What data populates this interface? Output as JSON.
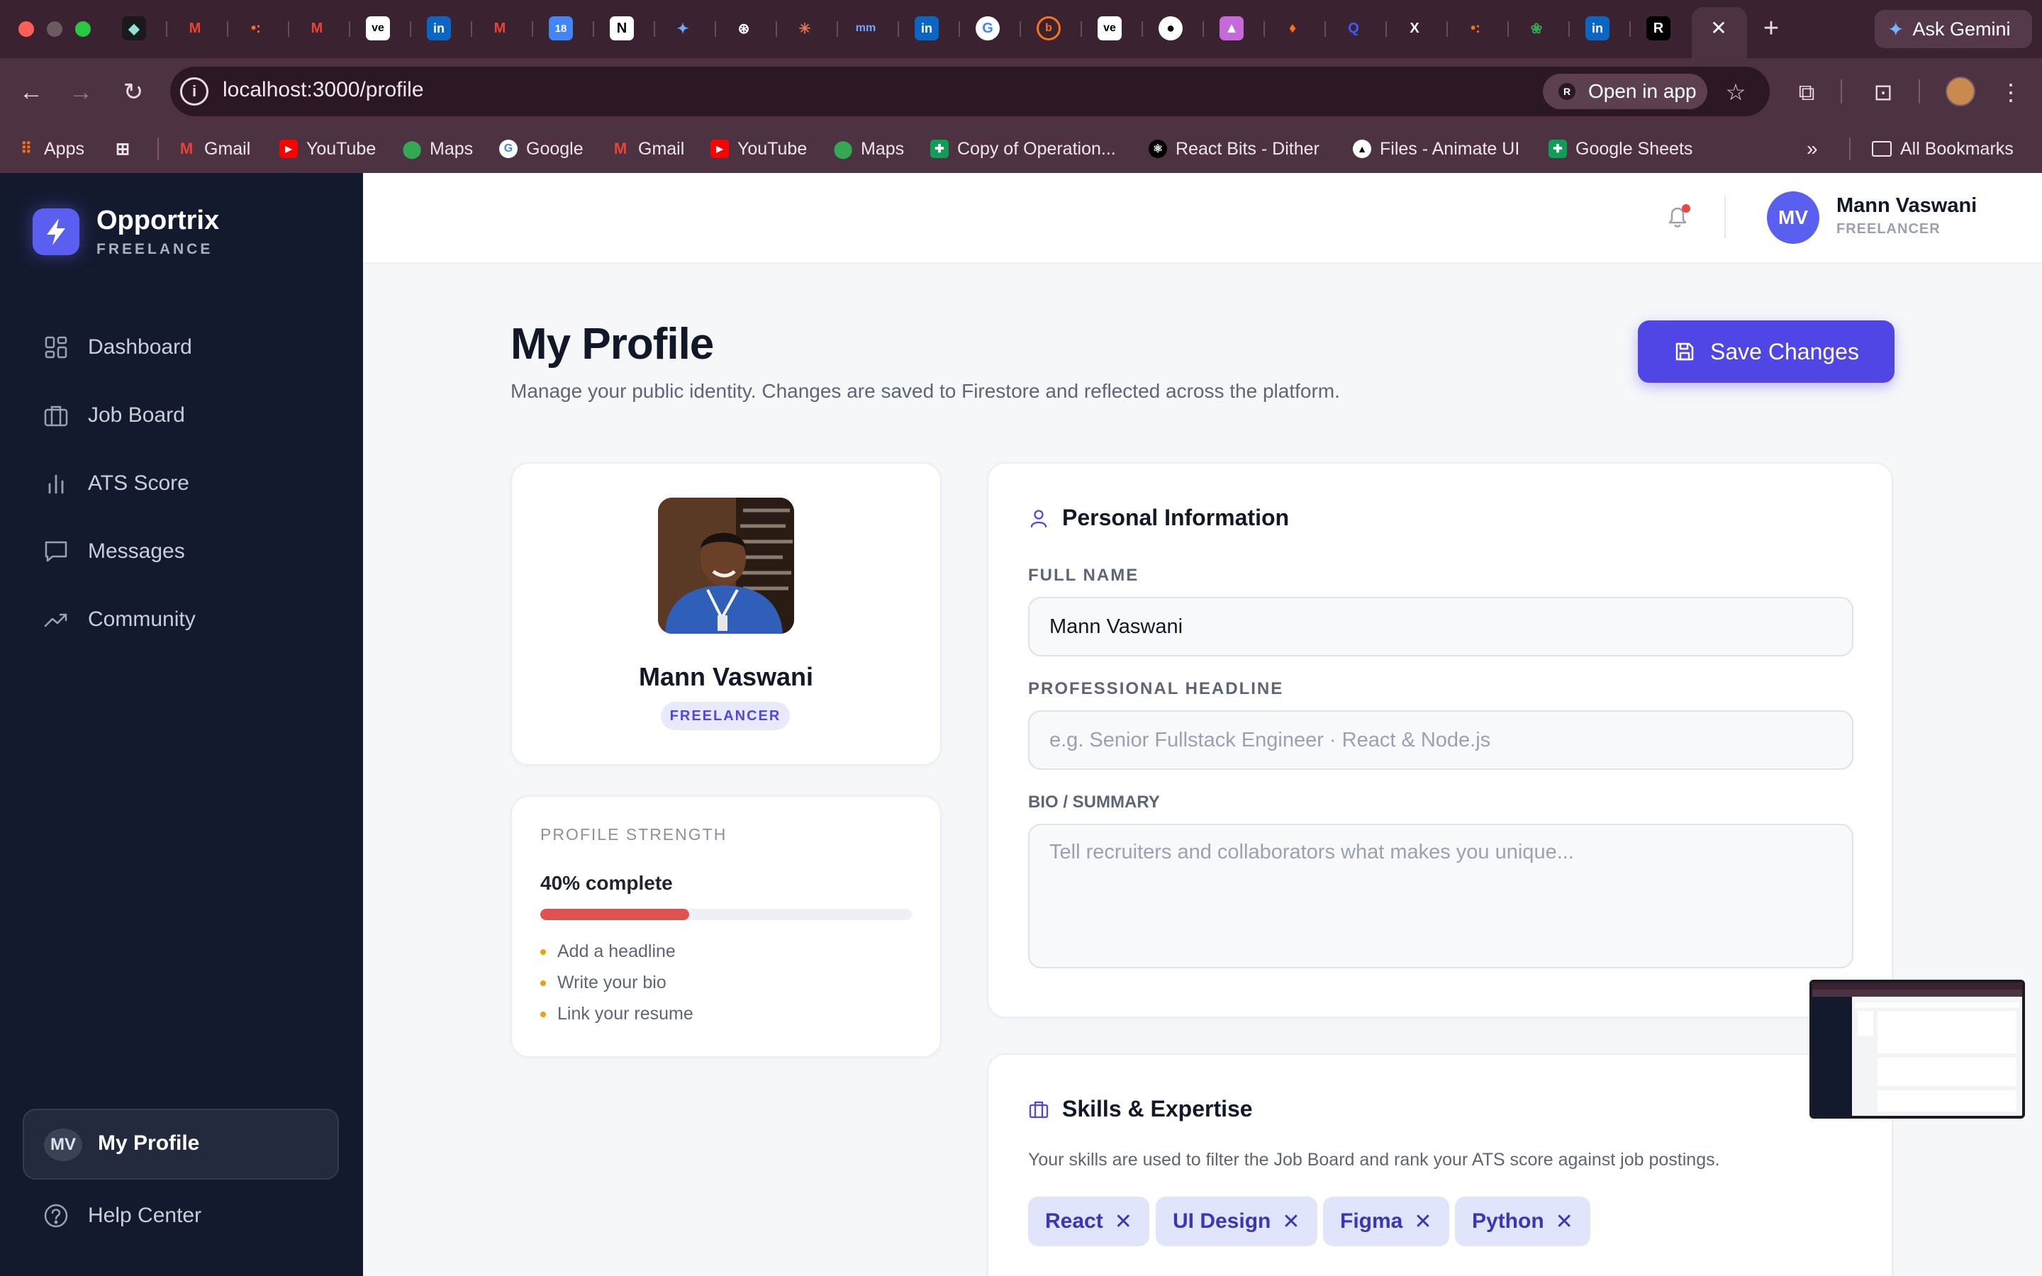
{
  "browser": {
    "url": "localhost:3000/profile",
    "open_in_app": "Open in app",
    "ask_gemini": "Ask Gemini",
    "bookmarks": [
      {
        "label": "Apps",
        "icon": "apps-grid-icon"
      },
      {
        "label": "Gmail",
        "icon": "gmail-icon"
      },
      {
        "label": "YouTube",
        "icon": "youtube-icon"
      },
      {
        "label": "Maps",
        "icon": "maps-icon"
      },
      {
        "label": "Google",
        "icon": "google-icon"
      },
      {
        "label": "Gmail",
        "icon": "gmail-icon"
      },
      {
        "label": "YouTube",
        "icon": "youtube-icon"
      },
      {
        "label": "Maps",
        "icon": "maps-icon"
      },
      {
        "label": "Copy of Operation...",
        "icon": "sheets-icon"
      },
      {
        "label": "React Bits - Dither",
        "icon": "reactbits-icon"
      },
      {
        "label": "Files - Animate UI",
        "icon": "animate-ui-icon"
      },
      {
        "label": "Google Sheets",
        "icon": "sheets-icon"
      }
    ],
    "all_bookmarks": "All Bookmarks"
  },
  "sidebar": {
    "brand": "Opportrix",
    "brand_sub": "FREELANCE",
    "items": [
      {
        "label": "Dashboard",
        "icon": "dashboard-icon"
      },
      {
        "label": "Job Board",
        "icon": "briefcase-icon"
      },
      {
        "label": "ATS Score",
        "icon": "bar-chart-icon"
      },
      {
        "label": "Messages",
        "icon": "message-icon"
      },
      {
        "label": "Community",
        "icon": "trending-icon"
      }
    ],
    "my_profile": {
      "initials": "MV",
      "label": "My Profile"
    },
    "help": "Help Center"
  },
  "header": {
    "initials": "MV",
    "name": "Mann Vaswani",
    "role": "FREELANCER"
  },
  "page": {
    "title": "My Profile",
    "subtitle": "Manage your public identity. Changes are saved to Firestore and reflected across the platform.",
    "save_label": "Save Changes"
  },
  "profile_card": {
    "name": "Mann Vaswani",
    "role": "FREELANCER"
  },
  "strength": {
    "label": "PROFILE STRENGTH",
    "percent_text": "40% complete",
    "percent": 40,
    "tips": [
      "Add a headline",
      "Write your bio",
      "Link your resume"
    ]
  },
  "personal": {
    "title": "Personal Information",
    "full_name_label": "FULL NAME",
    "full_name_value": "Mann Vaswani",
    "headline_label": "PROFESSIONAL HEADLINE",
    "headline_placeholder": "e.g. Senior Fullstack Engineer · React & Node.js",
    "bio_label": "BIO / SUMMARY",
    "bio_placeholder": "Tell recruiters and collaborators what makes you unique..."
  },
  "skills": {
    "title": "Skills & Expertise",
    "description": "Your skills are used to filter the Job Board and rank your ATS score against job postings.",
    "chips": [
      "React",
      "UI Design",
      "Figma",
      "Python"
    ]
  },
  "colors": {
    "accent": "#4f46e5",
    "sidebar_bg": "#141a2e",
    "progress_fill": "#e05252"
  }
}
